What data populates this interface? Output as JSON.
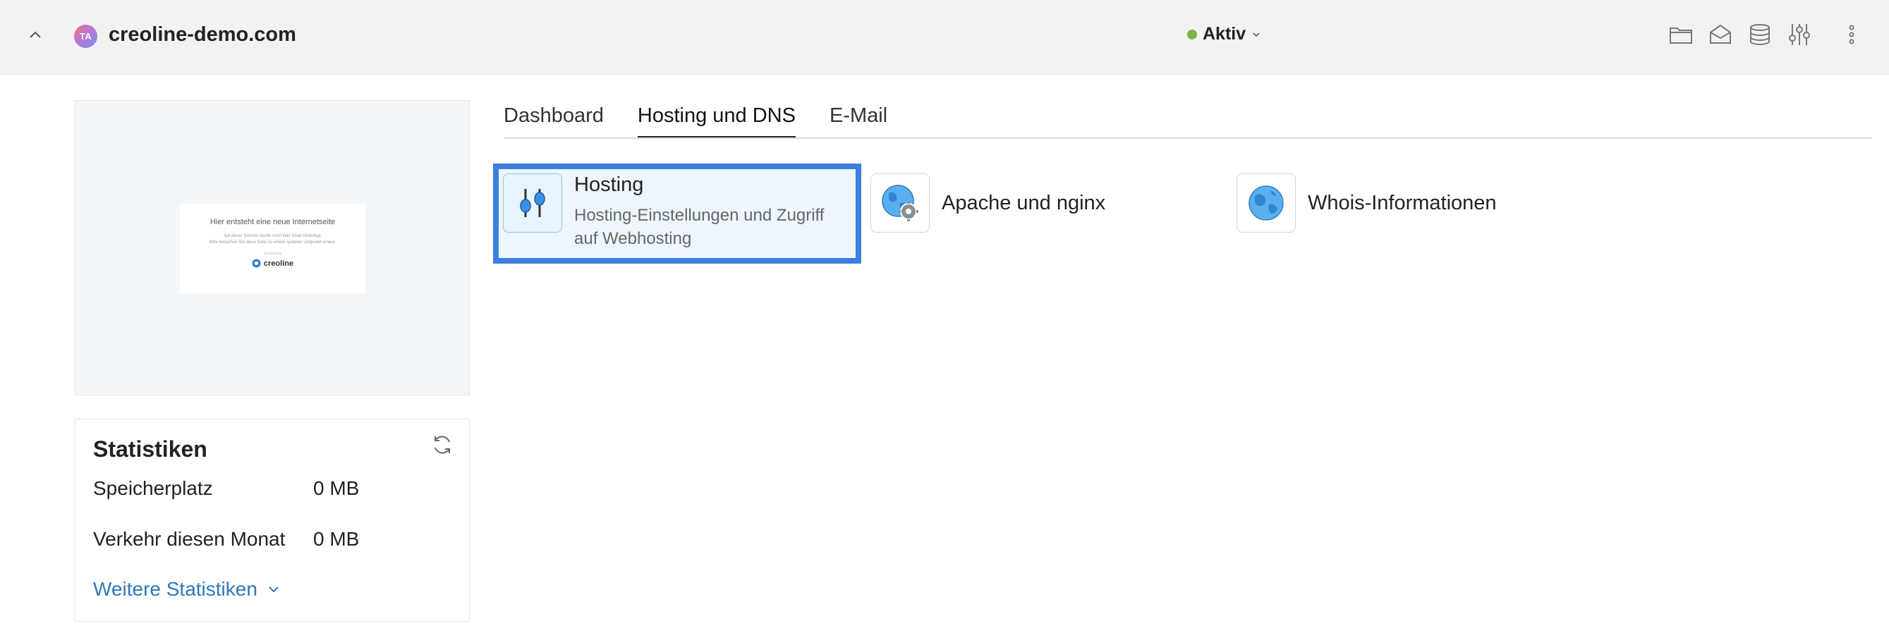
{
  "header": {
    "avatar_initials": "TA",
    "domain": "creoline-demo.com",
    "status": "Aktiv",
    "status_color": "#7ab648",
    "icons": [
      "folder-icon",
      "mail-icon",
      "database-icon",
      "sliders-icon"
    ],
    "more_icon": "kebab-menu-icon"
  },
  "preview": {
    "heading": "Hier entsteht eine neue Internetseite",
    "subtext_line1": "Auf dieser Domain wurde noch kein Inhalt hinterlegt.",
    "subtext_line2": "Bitte besuchen Sie diese Seite zu einem späteren Zeitpunkt erneut.",
    "powered_by": "powered by",
    "logo_text": "creoline"
  },
  "stats": {
    "title": "Statistiken",
    "rows": [
      {
        "label": "Speicherplatz",
        "value": "0 MB"
      },
      {
        "label": "Verkehr diesen Monat",
        "value": "0 MB"
      }
    ],
    "more_link": "Weitere Statistiken"
  },
  "tabs": [
    {
      "label": "Dashboard",
      "active": false
    },
    {
      "label": "Hosting und DNS",
      "active": true
    },
    {
      "label": "E-Mail",
      "active": false
    }
  ],
  "tiles": {
    "hosting": {
      "title": "Hosting",
      "description": "Hosting-Einstellungen und Zugriff auf Webhosting",
      "icon": "sliders-icon"
    },
    "apache": {
      "title": "Apache und nginx",
      "icon": "globe-gear-icon"
    },
    "whois": {
      "title": "Whois-Informationen",
      "icon": "globe-icon"
    }
  },
  "colors": {
    "accent_blue": "#3d7fe0",
    "link_blue": "#2e78b7",
    "topbar_bg": "#f2f2f2"
  }
}
